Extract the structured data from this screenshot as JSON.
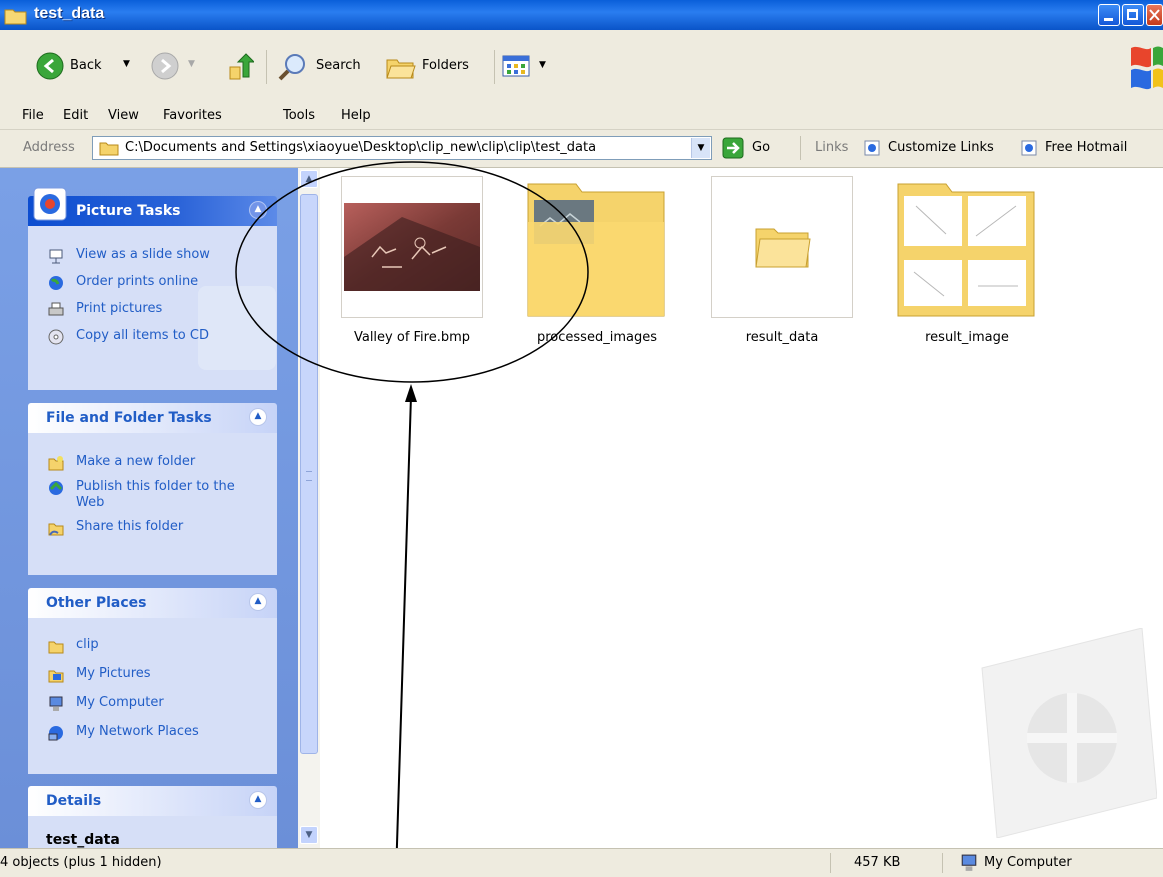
{
  "window": {
    "title": "test_data"
  },
  "toolbar": {
    "back": "Back",
    "search": "Search",
    "folders": "Folders"
  },
  "menu": [
    "File",
    "Edit",
    "View",
    "Favorites",
    "Tools",
    "Help"
  ],
  "address": {
    "label": "Address",
    "path": "C:\\Documents and Settings\\xiaoyue\\Desktop\\clip_new\\clip\\clip\\test_data",
    "go": "Go",
    "links_label": "Links",
    "links": [
      "Customize Links",
      "Free Hotmail"
    ]
  },
  "left_pane": {
    "picture_tasks": {
      "title": "Picture Tasks",
      "items": [
        "View as a slide show",
        "Order prints online",
        "Print pictures",
        "Copy all items to CD"
      ]
    },
    "file_folder_tasks": {
      "title": "File and Folder Tasks",
      "items": [
        "Make a new folder",
        "Publish this folder to the Web",
        "Share this folder"
      ]
    },
    "other_places": {
      "title": "Other Places",
      "items": [
        "clip",
        "My Pictures",
        "My Computer",
        "My Network Places"
      ]
    },
    "details": {
      "title": "Details",
      "name": "test_data"
    }
  },
  "files": [
    {
      "name": "Valley of Fire.bmp",
      "icon": "image-thumbnail"
    },
    {
      "name": "processed_images",
      "icon": "folder-with-preview-icon"
    },
    {
      "name": "result_data",
      "icon": "folder-icon"
    },
    {
      "name": "result_image",
      "icon": "folder-with-preview-icon"
    }
  ],
  "status_bar": {
    "objects": "4 objects (plus 1 hidden)",
    "size": "457 KB",
    "location": "My Computer"
  },
  "colors": {
    "title_bar": "#0a5fd9",
    "task_pane": "#6b8fd8",
    "link_text": "#215dc6"
  }
}
